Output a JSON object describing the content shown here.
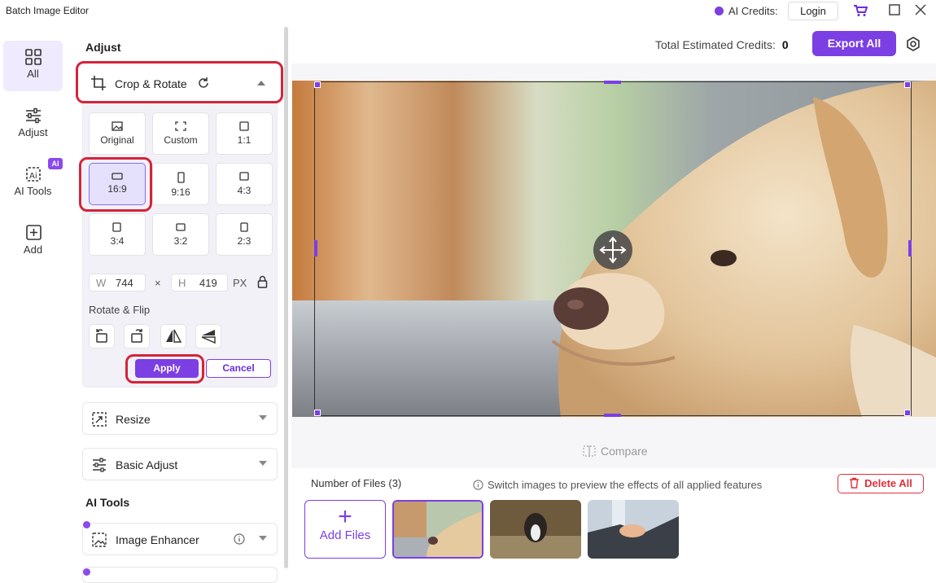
{
  "app": {
    "title": "Batch Image Editor",
    "ai_credits_label": "AI Credits:",
    "login_label": "Login"
  },
  "rail": {
    "items": [
      {
        "label": "All",
        "icon": "grid-icon",
        "active": true
      },
      {
        "label": "Adjust",
        "icon": "sliders-icon"
      },
      {
        "label": "AI Tools",
        "icon": "ai-tools-icon",
        "badge": "AI"
      },
      {
        "label": "Add",
        "icon": "add-square-icon"
      }
    ]
  },
  "panel": {
    "heading": "Adjust",
    "crop": {
      "title": "Crop & Rotate",
      "ratios": [
        "Original",
        "Custom",
        "1:1",
        "16:9",
        "9:16",
        "4:3",
        "3:4",
        "3:2",
        "2:3"
      ],
      "selected_ratio": "16:9",
      "width_key": "W",
      "width": "744",
      "times": "×",
      "height_key": "H",
      "height": "419",
      "unit": "PX",
      "rotate_flip_label": "Rotate & Flip",
      "apply_label": "Apply",
      "cancel_label": "Cancel"
    },
    "resize_label": "Resize",
    "basic_adjust_label": "Basic Adjust",
    "ai_tools_heading": "AI Tools",
    "image_enhancer_label": "Image Enhancer"
  },
  "main": {
    "estimated_label": "Total Estimated Credits:",
    "estimated_value": "0",
    "export_label": "Export All",
    "compare_label": "Compare",
    "files_label": "Number of Files (3)",
    "hint": "Switch images to preview the effects of all applied features",
    "delete_label": "Delete All",
    "add_files_label": "Add Files"
  },
  "colors": {
    "accent": "#7b3fe4",
    "danger": "#e0303c",
    "highlight_ring": "#d3243a"
  }
}
